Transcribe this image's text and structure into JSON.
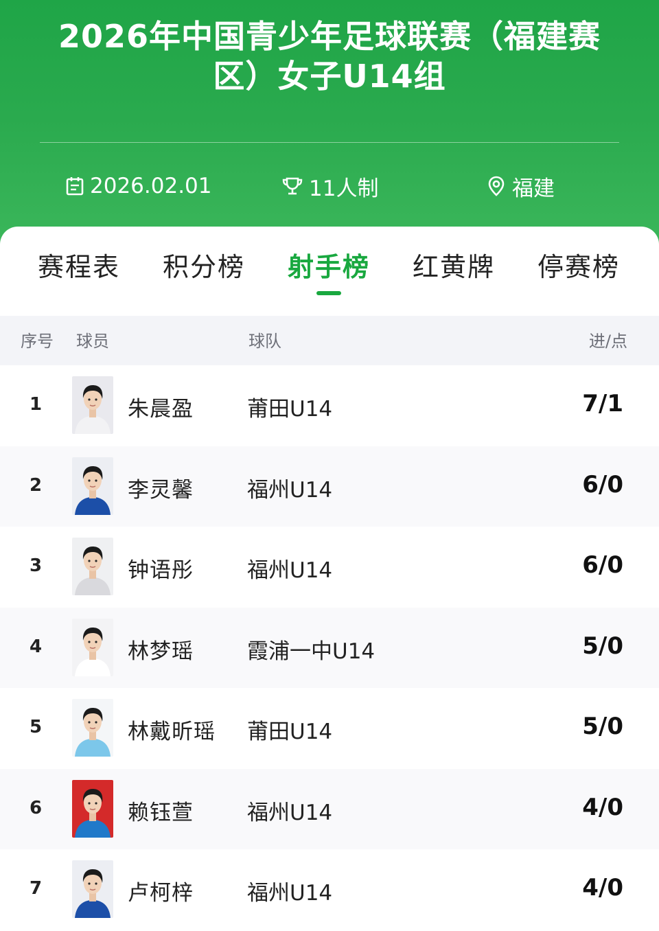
{
  "header": {
    "title_line1": "2026年中国青少年足球联赛（福建赛",
    "title_line2": "区）女子U14组",
    "date": "2026.02.01",
    "format": "11人制",
    "location": "福建",
    "colors": {
      "primary": "#1fa547",
      "accent": "#19a83f"
    }
  },
  "tabs": [
    {
      "label": "赛程表",
      "active": false
    },
    {
      "label": "积分榜",
      "active": false
    },
    {
      "label": "射手榜",
      "active": true
    },
    {
      "label": "红黄牌",
      "active": false
    },
    {
      "label": "停赛榜",
      "active": false
    }
  ],
  "table": {
    "columns": {
      "rank": "序号",
      "player": "球员",
      "team": "球队",
      "goals": "进/点"
    },
    "rows": [
      {
        "rank": "1",
        "name": "朱晨盈",
        "team": "莆田U14",
        "goals": "7/1",
        "photo_bg": "#e9e9ee",
        "shirt": "#f2f2f4"
      },
      {
        "rank": "2",
        "name": "李灵馨",
        "team": "福州U14",
        "goals": "6/0",
        "photo_bg": "#eceef3",
        "shirt": "#1c4fa8"
      },
      {
        "rank": "3",
        "name": "钟语彤",
        "team": "福州U14",
        "goals": "6/0",
        "photo_bg": "#eff0f2",
        "shirt": "#d9d9dd"
      },
      {
        "rank": "4",
        "name": "林梦瑶",
        "team": "霞浦一中U14",
        "goals": "5/0",
        "photo_bg": "#f3f3f5",
        "shirt": "#ffffff"
      },
      {
        "rank": "5",
        "name": "林戴昕瑶",
        "team": "莆田U14",
        "goals": "5/0",
        "photo_bg": "#f4f6f8",
        "shirt": "#7cc7ea"
      },
      {
        "rank": "6",
        "name": "赖钰萱",
        "team": "福州U14",
        "goals": "4/0",
        "photo_bg": "#d42a2a",
        "shirt": "#2079c9"
      },
      {
        "rank": "7",
        "name": "卢柯梓",
        "team": "福州U14",
        "goals": "4/0",
        "photo_bg": "#eceef3",
        "shirt": "#1c4fa8"
      }
    ]
  }
}
